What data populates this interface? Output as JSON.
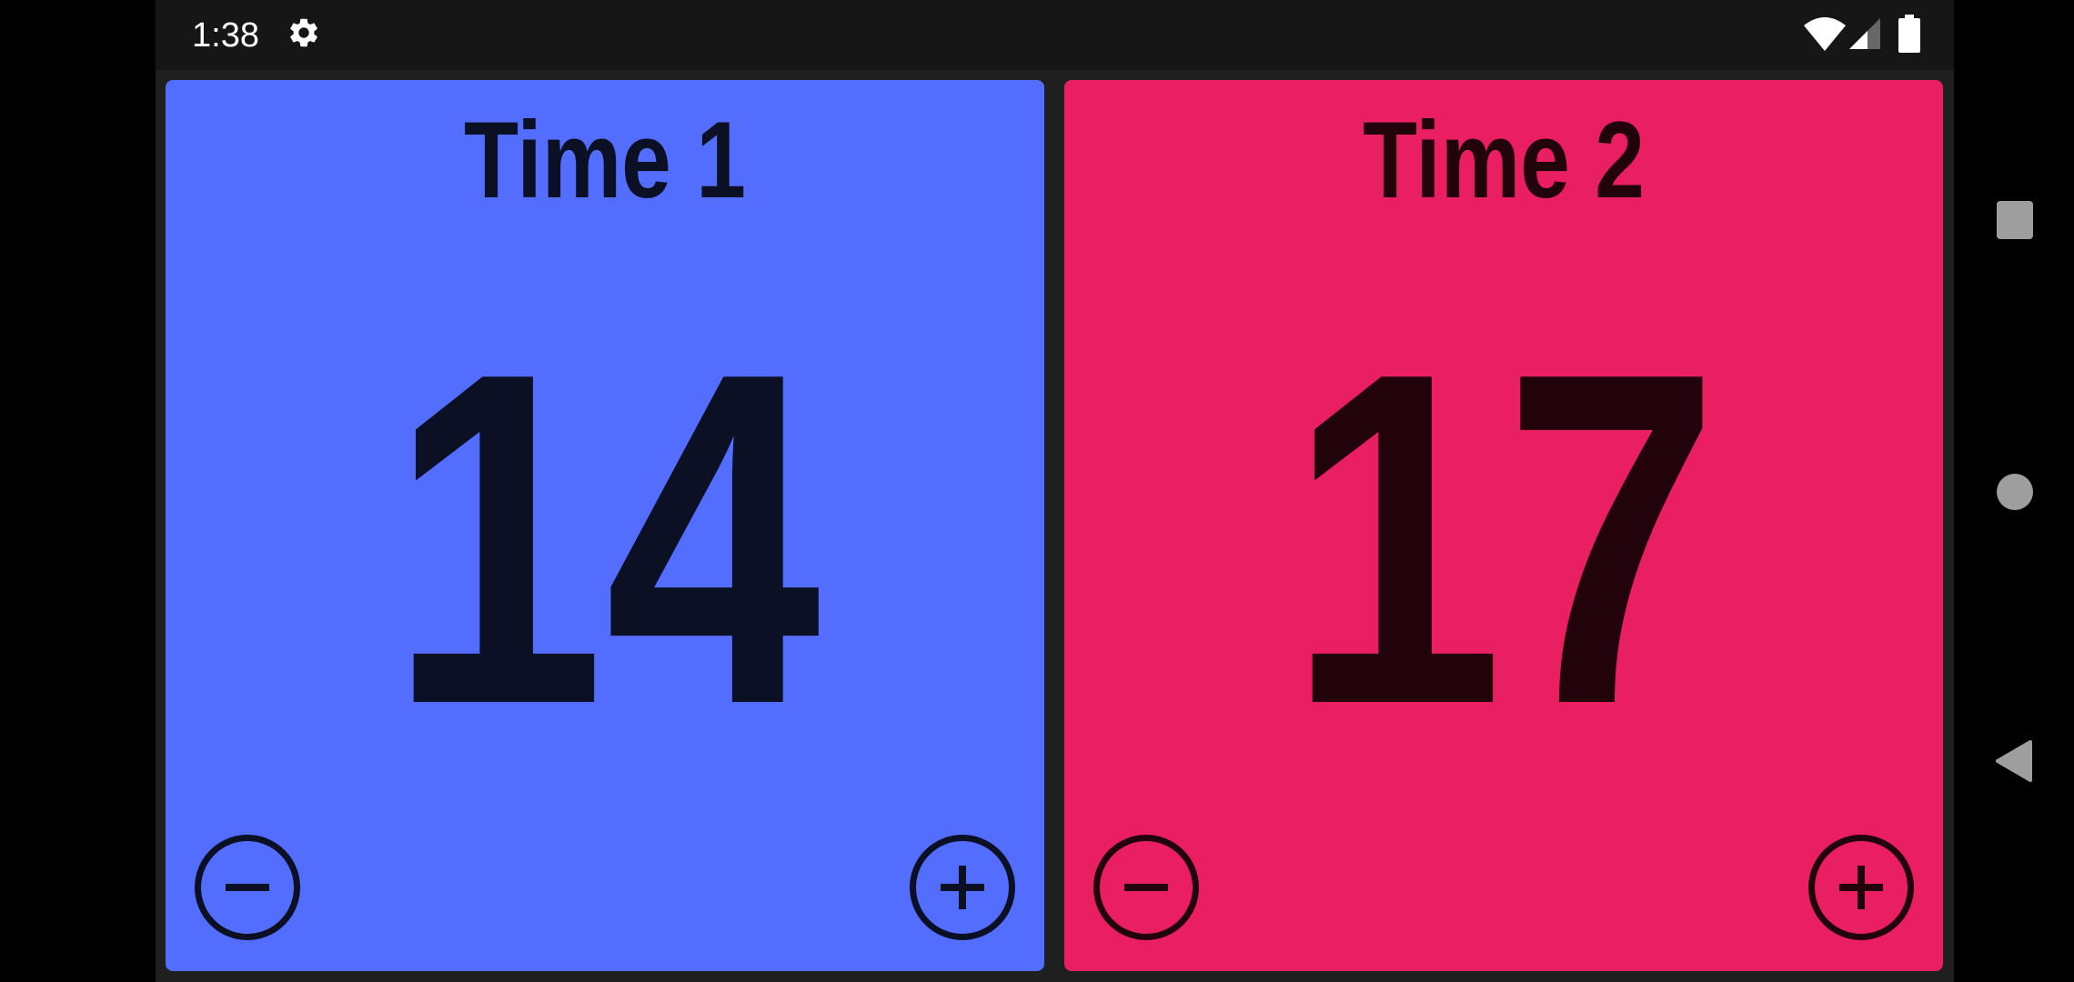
{
  "status_bar": {
    "time": "1:38",
    "icons": [
      "settings-icon",
      "wifi-icon",
      "cellular-signal-icon",
      "battery-icon"
    ]
  },
  "teams": [
    {
      "name": "Time 1",
      "score": "14",
      "bg_color": "#536dfe",
      "fg_color": "#0b1024"
    },
    {
      "name": "Time 2",
      "score": "17",
      "bg_color": "#e91e63",
      "fg_color": "#22030c"
    }
  ],
  "controls": {
    "decrement_icon": "minus-circle-icon",
    "increment_icon": "plus-circle-icon"
  },
  "nav_bar": {
    "buttons": [
      "recents-button",
      "home-button",
      "back-button"
    ]
  }
}
